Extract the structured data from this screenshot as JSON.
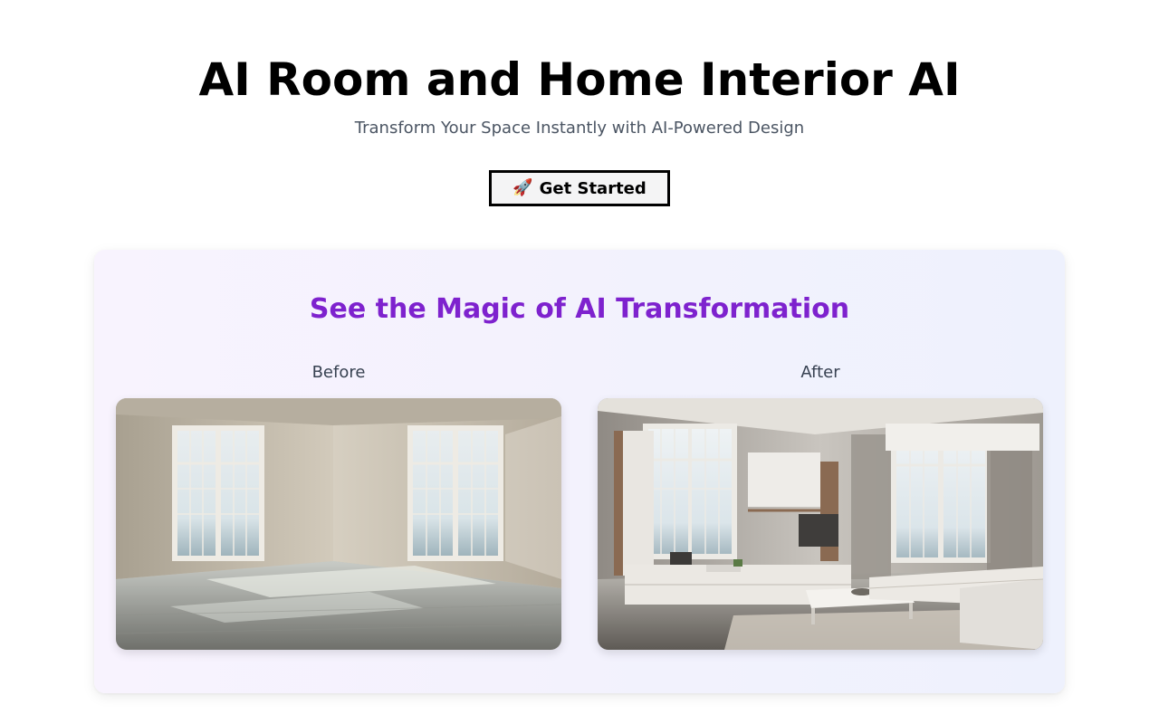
{
  "hero": {
    "title": "AI Room and Home Interior AI",
    "subtitle": "Transform Your Space Instantly with AI-Powered Design",
    "cta_icon": "🚀",
    "cta_label": "Get Started"
  },
  "showcase": {
    "title": "See the Magic of AI Transformation",
    "before_label": "Before",
    "after_label": "After"
  },
  "colors": {
    "accent_purple": "#7e22ce",
    "subtitle_gray": "#4b5563",
    "label_gray": "#374151"
  }
}
